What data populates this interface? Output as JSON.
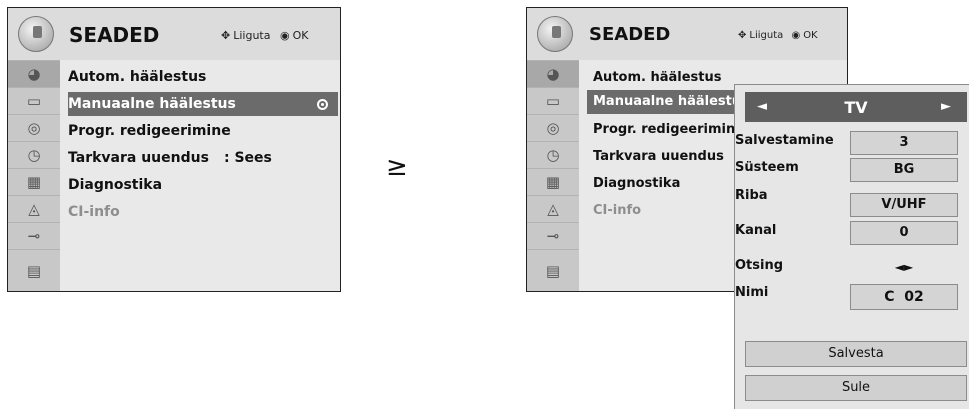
{
  "left_panel": {
    "title": "SEADED",
    "hint_move": "Liiguta",
    "hint_ok": "OK",
    "menu": [
      {
        "label": "Autom. häälestus"
      },
      {
        "label": "Manuaalne häälestus"
      },
      {
        "label": "Progr. redigeerimine"
      },
      {
        "label": "Tarkvara uuendus",
        "value": ": Sees"
      },
      {
        "label": "Diagnostika"
      },
      {
        "label": "CI-info"
      }
    ]
  },
  "arrow_symbol": "≥",
  "right_panel": {
    "title": "SEADED",
    "hint_move": "Liiguta",
    "hint_ok": "OK",
    "menu": [
      {
        "label": "Autom. häälestus"
      },
      {
        "label": "Manuaalne häälestus"
      },
      {
        "label": "Progr. redigeerimine"
      },
      {
        "label": "Tarkvara uuendus"
      },
      {
        "label": "Diagnostika"
      },
      {
        "label": "CI-info"
      }
    ]
  },
  "submenu": {
    "mode": "TV",
    "fields": [
      {
        "label": "Salvestamine",
        "value": "3"
      },
      {
        "label": "Süsteem",
        "value": "BG"
      },
      {
        "label": "Riba",
        "value": "V/UHF"
      },
      {
        "label": "Kanal",
        "value": "0"
      },
      {
        "label": "Otsing",
        "value": "◄►"
      },
      {
        "label": "Nimi",
        "value": "C  02"
      }
    ],
    "save_label": "Salvesta",
    "close_label": "Sule"
  },
  "sidebar_icons": [
    "satellite-icon",
    "picture-icon",
    "audio-icon",
    "clock-icon",
    "options-icon",
    "lock-icon",
    "input-icon",
    "usb-icon"
  ]
}
